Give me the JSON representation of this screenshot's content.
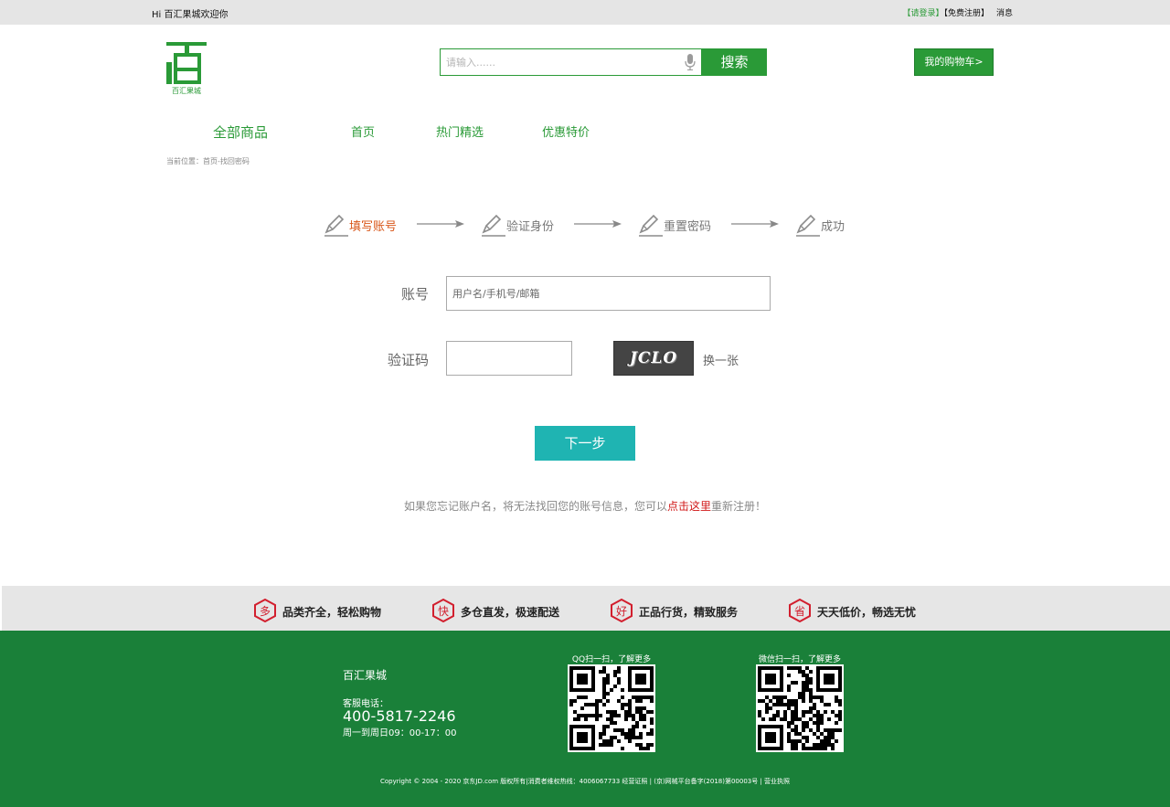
{
  "colors": {
    "brand": "#2a9a37",
    "footer": "#1a8039",
    "active_step": "#d9571a",
    "next_button": "#1fb4b2",
    "link": "#d01717",
    "feature_icon": "#d21f2e"
  },
  "topbar": {
    "greeting": "Hi 百汇果城欢迎你",
    "login": "【请登录】",
    "register": "【免费注册】",
    "messages": "消息"
  },
  "header": {
    "logo_char": "百",
    "logo_text": "百汇果城",
    "search_placeholder": "请输入......",
    "search_button": "搜索",
    "mic_icon": "microphone-icon",
    "cart_button": "我的购物车>"
  },
  "nav": {
    "all": "全部商品",
    "items": [
      "首页",
      "热门精选",
      "优惠特价"
    ]
  },
  "breadcrumb": "当前位置：首页-找回密码",
  "steps": [
    "填写账号",
    "验证身份",
    "重置密码",
    "成功"
  ],
  "active_step": 0,
  "step_icon": "pencil-icon",
  "arrow_icon": "arrow-right-icon",
  "form": {
    "account_label": "账号",
    "account_placeholder": "用户名/手机号/邮箱",
    "captcha_label": "验证码",
    "captcha_value": "",
    "captcha_image_text": "JCLO",
    "refresh_label": "换一张",
    "next_button": "下一步"
  },
  "hint": {
    "prefix": "如果您忘记账户名，将无法找回您的账号信息，您可以",
    "link": "点击这里",
    "suffix": "重新注册！"
  },
  "features": [
    {
      "icon": "多",
      "text": "品类齐全，轻松购物"
    },
    {
      "icon": "快",
      "text": "多仓直发，极速配送"
    },
    {
      "icon": "好",
      "text": "正品行货，精致服务"
    },
    {
      "icon": "省",
      "text": "天天低价，畅选无忧"
    }
  ],
  "footer": {
    "brand": "百汇果城",
    "service_label": "客服电话：",
    "phone": "400-5817-2246",
    "hours": "周一到周日09：00-17：00",
    "qr_qq_caption": "QQ扫一扫，了解更多",
    "qr_wechat_caption": "微信扫一扫，了解更多",
    "copyright": "Copyright © 2004 - 2020 京东JD.com 版权所有|消费者维权热线：4006067733 经营证照 | (京)网械平台备字(2018)第00003号 | 营业执照"
  }
}
